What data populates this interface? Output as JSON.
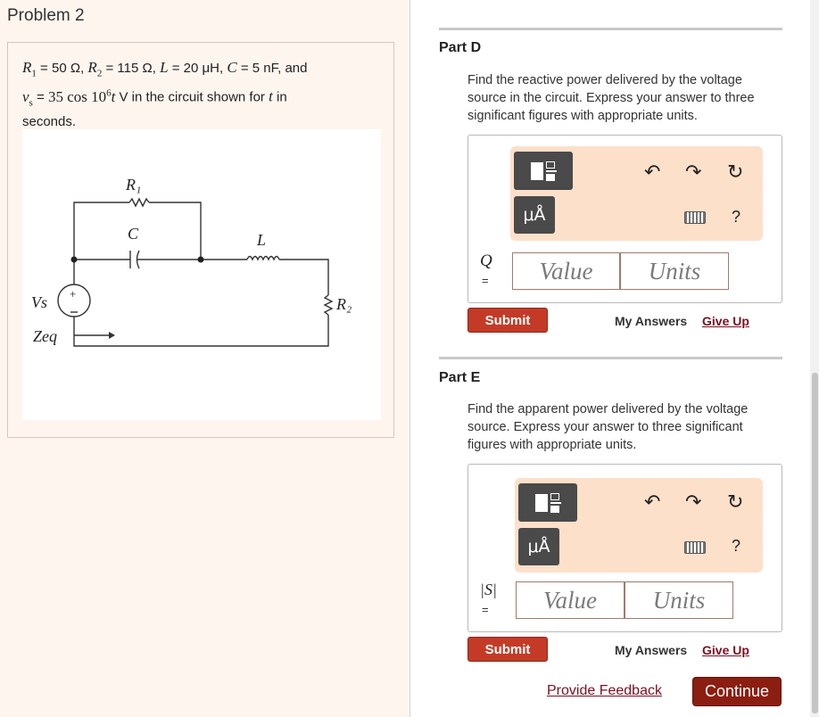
{
  "problem": {
    "title": "Problem 2",
    "r1_name": "R",
    "r1_sub": "1",
    "r1_value": "50 Ω",
    "r2_name": "R",
    "r2_sub": "2",
    "r2_value": "115 Ω",
    "l_name": "L",
    "l_value": "20 μH",
    "c_name": "C",
    "c_value": "5 nF",
    "and_text": ", and",
    "vs_name": "v",
    "vs_sub": "s",
    "vs_expr": "35 cos 10",
    "vs_exp": "6",
    "vs_t": "t",
    "vs_unit": " V in the circuit shown for ",
    "t_var": "t",
    "in_text": " in",
    "seconds_text": "seconds."
  },
  "circuit": {
    "label_r1": "R₁",
    "label_c": "C",
    "label_l": "L",
    "label_r2": "R₂",
    "label_vs": "Vs",
    "label_zeq": "Zeq",
    "plus_sign": "+"
  },
  "parts": [
    {
      "title": "Part D",
      "description": "Find the reactive power delivered by the voltage source in the circuit.  Express your answer to three significant figures with appropriate units.",
      "field_label": "Q",
      "equals": "=",
      "value_placeholder": "Value",
      "units_placeholder": "Units",
      "units_button": "μÅ",
      "help": "?",
      "submit": "Submit",
      "my_answers": "My Answers",
      "give_up": "Give Up"
    },
    {
      "title": "Part E",
      "description": "Find the apparent power delivered by the voltage source.  Express your answer to three significant figures with appropriate units.",
      "field_label": "|S|",
      "equals": "=",
      "value_placeholder": "Value",
      "units_placeholder": "Units",
      "units_button": "μÅ",
      "help": "?",
      "submit": "Submit",
      "my_answers": "My Answers",
      "give_up": "Give Up"
    }
  ],
  "footer": {
    "feedback": "Provide Feedback",
    "continue": "Continue"
  },
  "icons": {
    "undo": "undo-icon",
    "redo": "redo-icon",
    "reset": "reset-icon",
    "keyboard": "keyboard-icon",
    "templates": "templates-icon"
  },
  "colors": {
    "submit": "#c33b27",
    "continue": "#8b1e10",
    "link": "#7a1020",
    "toolbar": "#fde0c9",
    "problem_bg": "#fff5ef"
  }
}
